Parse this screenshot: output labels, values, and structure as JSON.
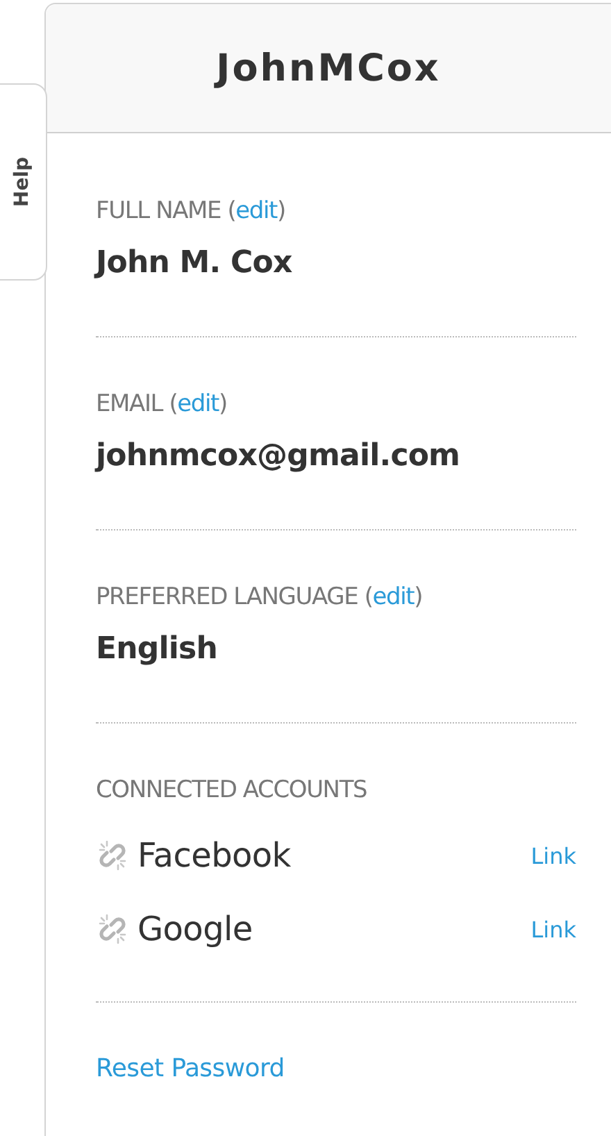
{
  "help_tab": {
    "label": "Help"
  },
  "panel": {
    "title": "JohnMCox"
  },
  "fields": [
    {
      "label": "FULL NAME (",
      "edit": "edit",
      "label_end": ")",
      "value": "John M. Cox"
    },
    {
      "label": "EMAIL (",
      "edit": "edit",
      "label_end": ")",
      "value": "johnmcox@gmail.com"
    },
    {
      "label": "PREFERRED LANGUAGE (",
      "edit": "edit",
      "label_end": ")",
      "value": "English"
    }
  ],
  "connected_accounts": {
    "label": "CONNECTED ACCOUNTS",
    "accounts": [
      {
        "name": "Facebook",
        "action": "Link",
        "linked": false
      },
      {
        "name": "Google",
        "action": "Link",
        "linked": false
      }
    ]
  },
  "reset_password": "Reset Password"
}
